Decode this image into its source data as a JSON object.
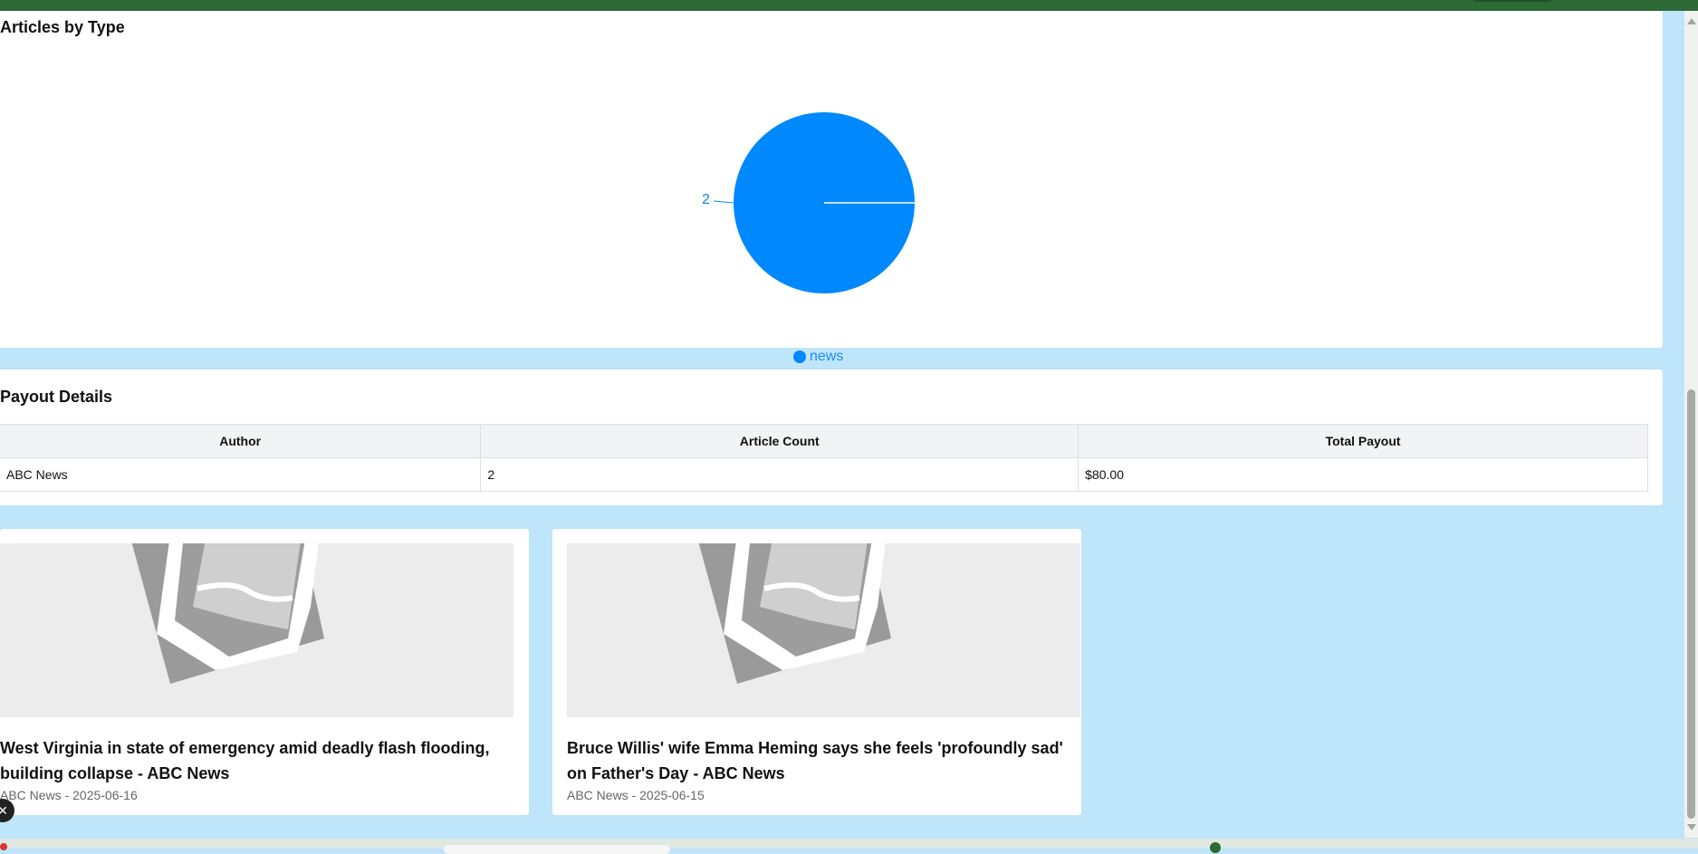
{
  "chart_card": {
    "title": "Articles by Type"
  },
  "chart_data": {
    "type": "pie",
    "title": "Articles by Type",
    "slices": [
      {
        "name": "news",
        "value": 2,
        "label": "2",
        "color": "#0088fe"
      }
    ],
    "legend": [
      "news"
    ],
    "legend_placement": "bottom"
  },
  "payout": {
    "title": "Payout Details",
    "columns": [
      "Author",
      "Article Count",
      "Total Payout"
    ],
    "rows": [
      [
        "ABC News",
        "2",
        "$80.00"
      ]
    ]
  },
  "articles": [
    {
      "title": "West Virginia in state of emergency amid deadly flash flooding, building collapse - ABC News",
      "meta": "ABC News - 2025-06-16"
    },
    {
      "title": "Bruce Willis' wife Emma Heming says she feels 'profoundly sad' on Father's Day - ABC News",
      "meta": "ABC News - 2025-06-15"
    }
  ],
  "colors": {
    "page_bg": "#bee5fa",
    "pie": "#0088fe",
    "top_bar": "#2d6a35"
  },
  "icons": {
    "thumbnail": "image-placeholder-icon",
    "float_button": "close-icon"
  },
  "float_button_label": "✕"
}
